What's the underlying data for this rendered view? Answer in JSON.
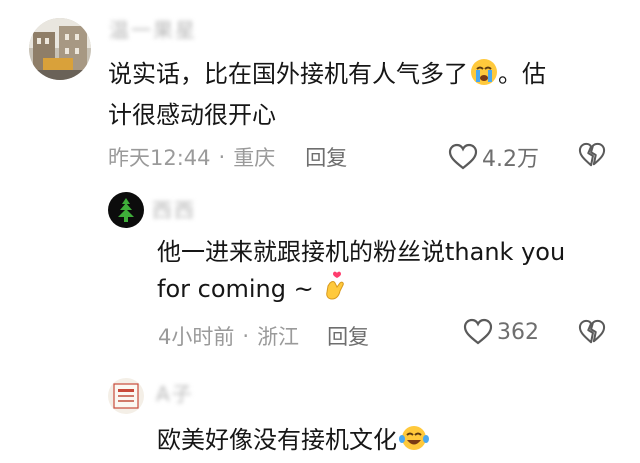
{
  "comments": [
    {
      "username": "温一果星",
      "text_line1": "说实话，比在国外接机有人气多了",
      "text_line1_tail": "。估",
      "text_line2": "计很感动很开心",
      "emoji": "crying-face",
      "time": "昨天12:44",
      "location": "重庆",
      "reply_label": "回复",
      "likes": "4.2万"
    },
    {
      "username": "西西",
      "text_line1": "他一进来就跟接机的粉丝说thank you",
      "text_line2": "for coming ~",
      "emoji": "finger-heart",
      "time": "4小时前",
      "location": "浙江",
      "reply_label": "回复",
      "likes": "362"
    },
    {
      "username": "A子",
      "text_line1": "欧美好像没有接机文化",
      "emoji": "tears-of-joy"
    }
  ],
  "separator": "·",
  "colors": {
    "text": "#161616",
    "meta": "#9a9a9a",
    "action": "#6e6e6e"
  }
}
